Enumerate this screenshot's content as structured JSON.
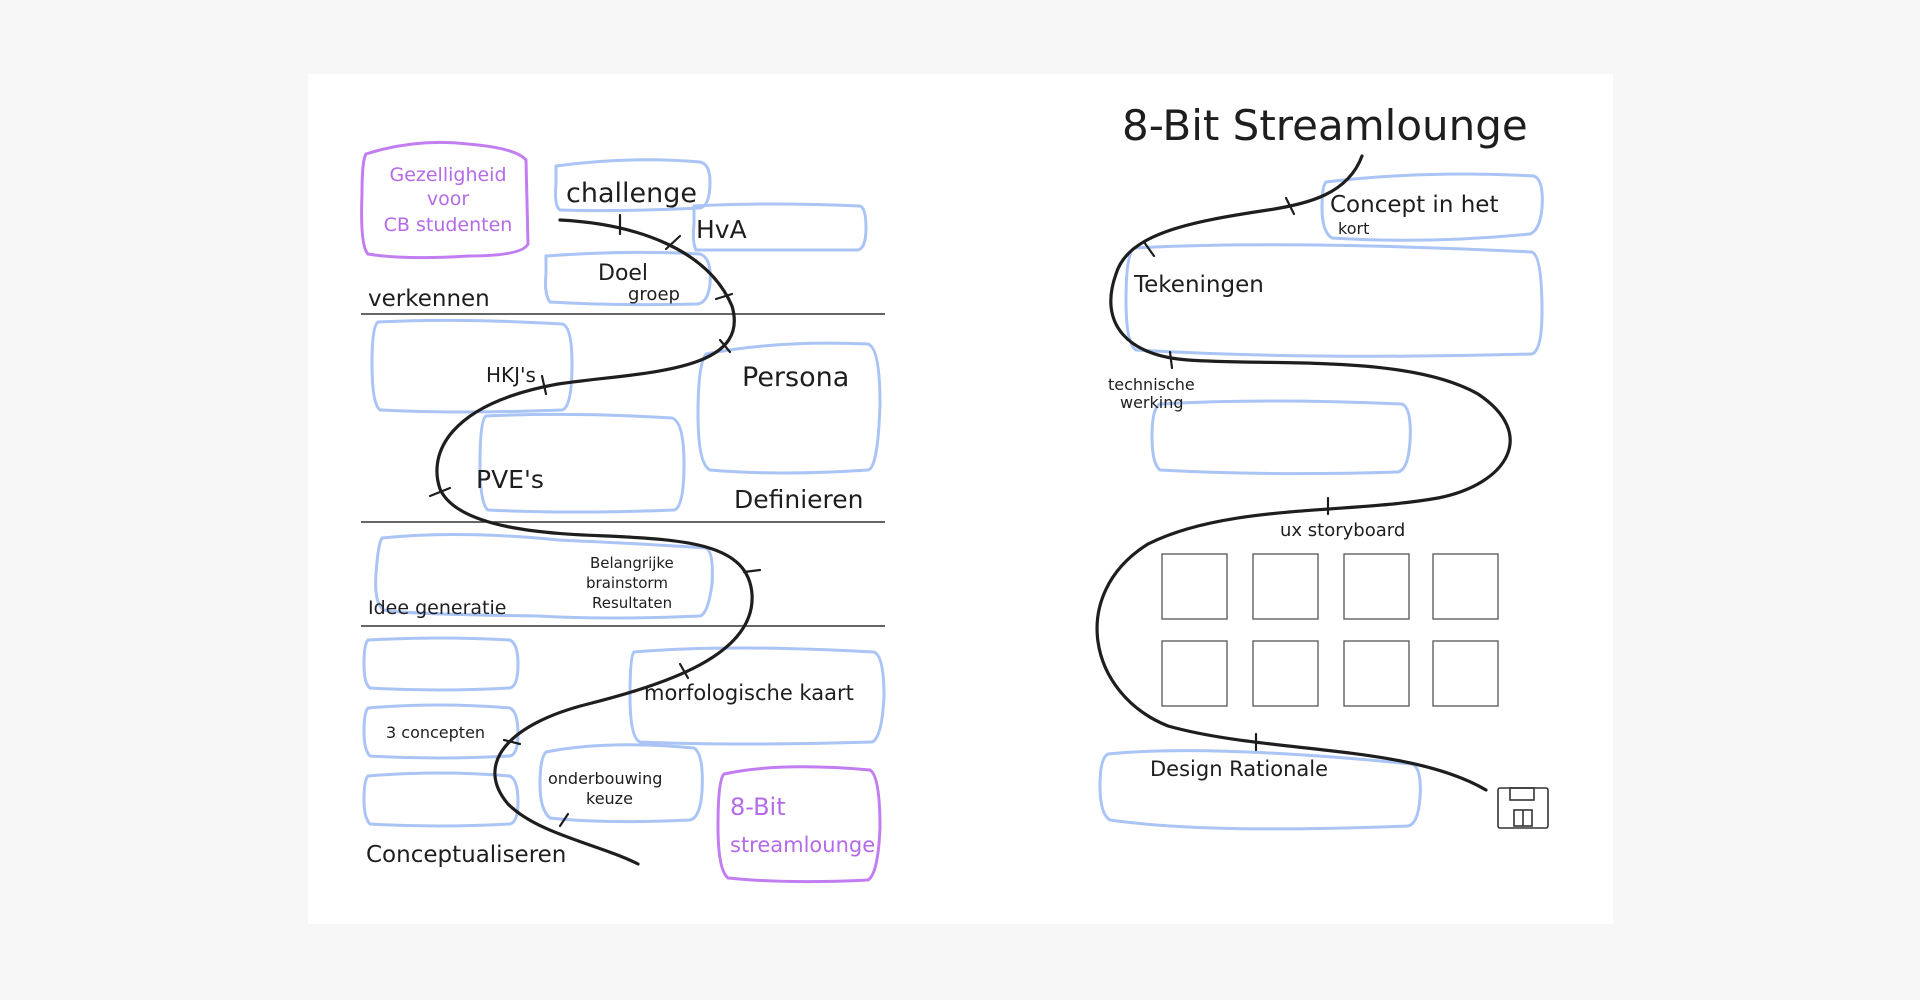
{
  "left_page": {
    "start_box": [
      "Gezelligheid",
      "voor",
      "CB studenten"
    ],
    "challenge": "challenge",
    "hva": "HvA",
    "doelgroep": [
      "Doel",
      "groep"
    ],
    "phase_verkennen": "verkennen",
    "hkjs": "HKJ's",
    "persona": "Persona",
    "pves": "PVE's",
    "phase_definieren": "Definieren",
    "brainstorm": [
      "Belangrijke",
      "brainstorm",
      "Resultaten"
    ],
    "phase_idee": "Idee generatie",
    "morfologische": "morfologische kaart",
    "drie_concepten": "3 concepten",
    "onderbouwing": [
      "onderbouwing",
      "keuze"
    ],
    "end_box": [
      "8-Bit",
      "streamlounge"
    ],
    "phase_concept": "Conceptualiseren"
  },
  "right_page": {
    "title": "8-Bit Streamlounge",
    "concept_kort": [
      "Concept in het",
      "kort"
    ],
    "tekeningen": "Tekeningen",
    "technische": [
      "technische",
      "werking"
    ],
    "storyboard": "ux storyboard",
    "design_rationale": "Design Rationale",
    "storyboard_frames": 8
  },
  "icons": {
    "end": "floppy-disk-icon"
  },
  "colors": {
    "box_stroke": "#a9c4f5",
    "highlight_stroke": "#c27ef0",
    "highlight_text": "#b56ae8",
    "path": "#1e1e1e",
    "background": "#f7f7f7"
  }
}
